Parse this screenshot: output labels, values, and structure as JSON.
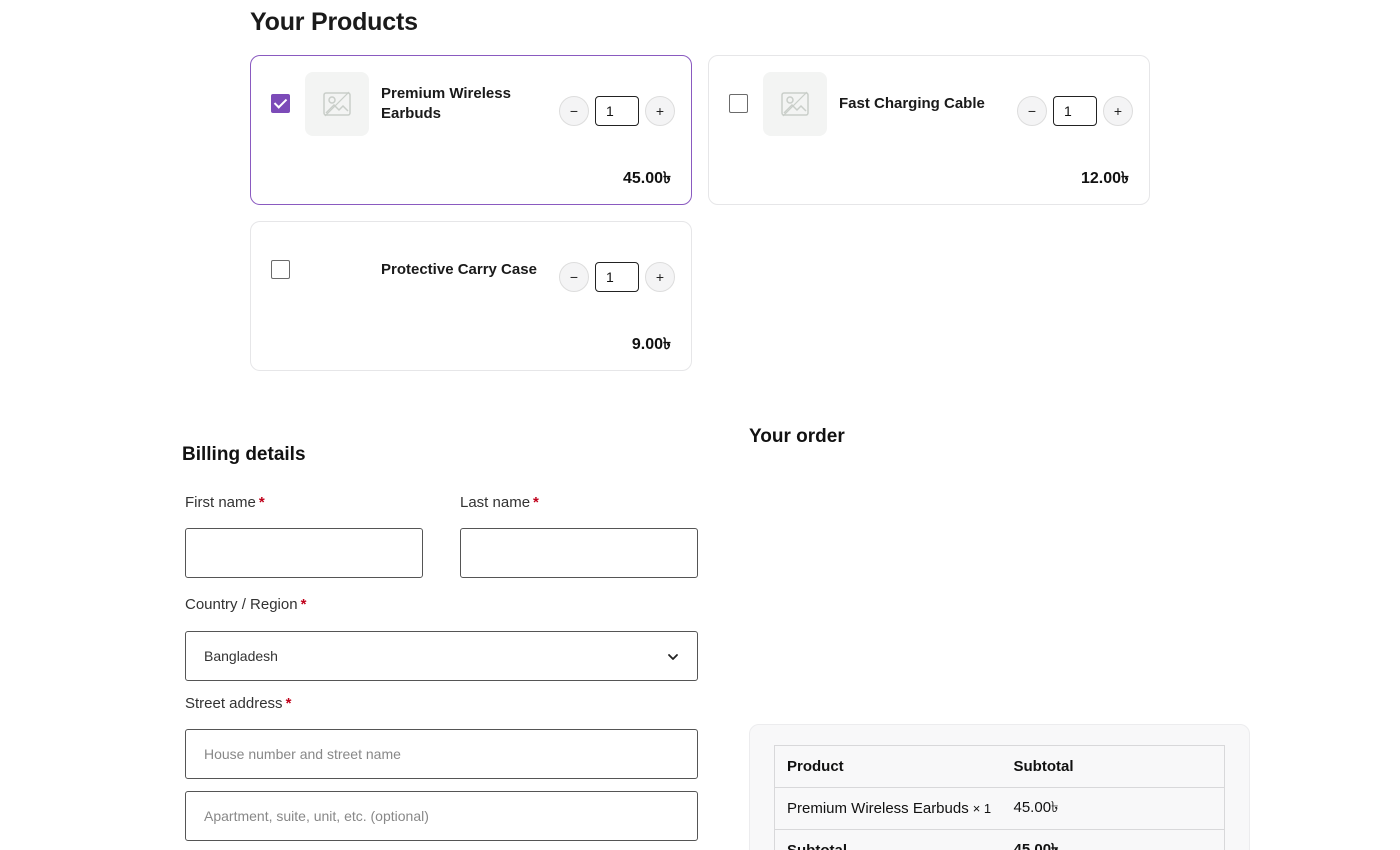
{
  "products_section": {
    "title": "Your Products",
    "items": [
      {
        "name": "Premium Wireless Earbuds",
        "qty": "1",
        "price": "45.00৳",
        "selected": true,
        "has_image": true
      },
      {
        "name": "Fast Charging Cable",
        "qty": "1",
        "price": "12.00৳",
        "selected": false,
        "has_image": true
      },
      {
        "name": "Protective Carry Case",
        "qty": "1",
        "price": "9.00৳",
        "selected": false,
        "has_image": false
      }
    ],
    "minus_symbol": "−",
    "plus_symbol": "+"
  },
  "billing": {
    "title": "Billing details",
    "required_mark": "*",
    "first_name_label": "First name",
    "last_name_label": "Last name",
    "country_label": "Country / Region",
    "country_value": "Bangladesh",
    "street_label": "Street address",
    "street_placeholder": "House number and street name",
    "apartment_placeholder": "Apartment, suite, unit, etc. (optional)"
  },
  "order": {
    "title": "Your order",
    "headers": [
      "Product",
      "Subtotal"
    ],
    "rows": [
      {
        "product": "Premium Wireless Earbuds",
        "qty": "× 1",
        "subtotal": "45.00৳"
      }
    ],
    "subtotal_label": "Subtotal",
    "subtotal_value": "45.00৳"
  },
  "colors": {
    "accent": "#7c4bb8",
    "selected_border": "#8a5ac0",
    "required": "#c0001a"
  }
}
